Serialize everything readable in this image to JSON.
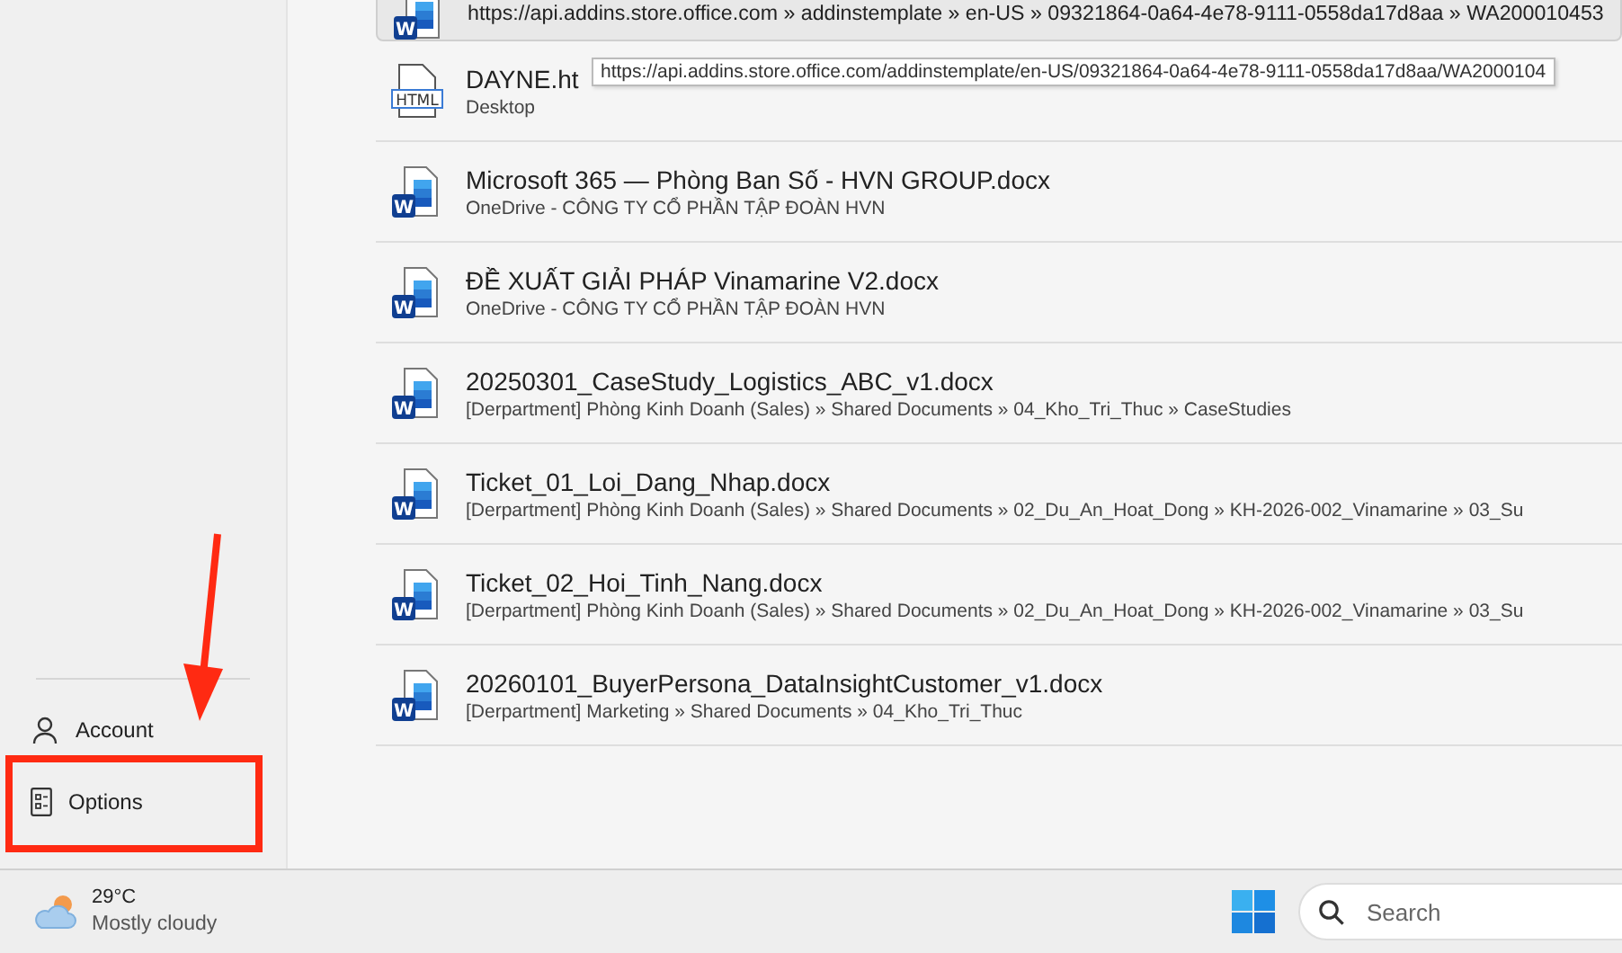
{
  "sidebar": {
    "items": [
      {
        "kind": "account",
        "label": "Account"
      },
      {
        "kind": "options",
        "label": "Options"
      }
    ]
  },
  "files": [
    {
      "kind": "word",
      "icon_label": "W",
      "selected": true,
      "title": "https://api.addins.store.office.com » addinstemplate » en-US » 09321864-0a64-4e78-9111-0558da17d8aa » WA200010453"
    },
    {
      "kind": "html",
      "icon_label": "HTML",
      "selected": false,
      "title": "DAYNE.ht",
      "location": "Desktop"
    },
    {
      "kind": "word",
      "icon_label": "W",
      "selected": false,
      "title": "Microsoft 365 — Phòng Ban Số - HVN GROUP.docx",
      "location": "OneDrive - CÔNG TY CỔ PHẦN TẬP ĐOÀN HVN"
    },
    {
      "kind": "word",
      "icon_label": "W",
      "selected": false,
      "title": "ĐỀ XUẤT GIẢI PHÁP Vinamarine  V2.docx",
      "location": "OneDrive - CÔNG TY CỔ PHẦN TẬP ĐOÀN HVN"
    },
    {
      "kind": "word",
      "icon_label": "W",
      "selected": false,
      "title": "20250301_CaseStudy_Logistics_ABC_v1.docx",
      "location": "[Derpartment] Phòng Kinh Doanh (Sales) » Shared Documents » 04_Kho_Tri_Thuc » CaseStudies"
    },
    {
      "kind": "word",
      "icon_label": "W",
      "selected": false,
      "title": "Ticket_01_Loi_Dang_Nhap.docx",
      "location": "[Derpartment] Phòng Kinh Doanh (Sales) » Shared Documents » 02_Du_An_Hoat_Dong » KH-2026-002_Vinamarine » 03_Su"
    },
    {
      "kind": "word",
      "icon_label": "W",
      "selected": false,
      "title": "Ticket_02_Hoi_Tinh_Nang.docx",
      "location": "[Derpartment] Phòng Kinh Doanh (Sales) » Shared Documents » 02_Du_An_Hoat_Dong » KH-2026-002_Vinamarine » 03_Su"
    },
    {
      "kind": "word",
      "icon_label": "W",
      "selected": false,
      "title": "20260101_BuyerPersona_DataInsightCustomer_v1.docx",
      "location": "[Derpartment] Marketing » Shared Documents » 04_Kho_Tri_Thuc"
    }
  ],
  "tooltip": "https://api.addins.store.office.com/addinstemplate/en-US/09321864-0a64-4e78-9111-0558da17d8aa/WA2000104",
  "taskbar": {
    "weather": {
      "temperature": "29°C",
      "condition": "Mostly cloudy"
    },
    "search": {
      "placeholder": "Search"
    }
  }
}
